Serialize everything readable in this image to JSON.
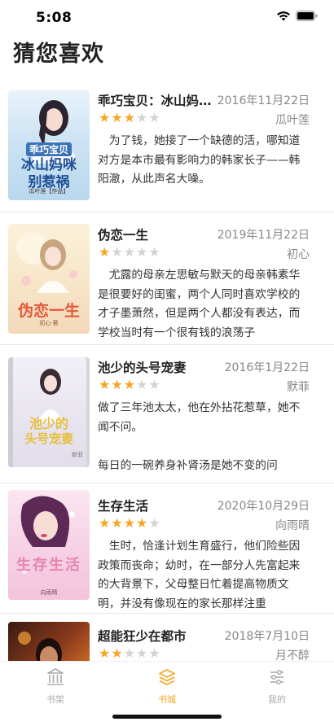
{
  "status": {
    "time": "5:08"
  },
  "page": {
    "title": "猜您喜欢"
  },
  "books": [
    {
      "title": "乖巧宝贝：冰山妈…",
      "date": "2016年11月22日",
      "author": "瓜叶莲",
      "rating": 3,
      "desc": "　为了钱，她接了一个缺德的活，哪知道对方是本市最有影响力的韩家长子——韩阳澈，从此声名大噪。",
      "cover": {
        "line1": "乖巧宝贝",
        "line2": "冰山妈咪",
        "line3": "别惹祸",
        "credit": "瓜叶莲【作品】"
      }
    },
    {
      "title": "伪恋一生",
      "date": "2019年11月22日",
      "author": "初心",
      "rating": 1,
      "desc": "　尤露的母亲左思敏与默天的母亲韩素华是很要好的闺蜜，两个人同时喜欢学校的才子墨萧然，但是两个人都没有表达，而学校当时有一个很有钱的浪荡子",
      "cover": {
        "line1": "伪恋一生",
        "credit": "初心·著"
      }
    },
    {
      "title": "池少的头号宠妻",
      "date": "2016年1月22日",
      "author": "默菲",
      "rating": 3,
      "desc": "做了三年池太太，他在外拈花惹草，她不闻不问。\n\n每日的一碗养身补肾汤是她不变的问",
      "cover": {
        "line1": "池少的",
        "line2": "头号宠妻",
        "credit": "默菲"
      }
    },
    {
      "title": "生存生活",
      "date": "2020年10月29日",
      "author": "向雨晴",
      "rating": 4,
      "desc": "　生时，恰逢计划生育盛行，他们险些因政策而丧命；幼时，在一部分人先富起来的大背景下，父母整日忙着提高物质文明，并没有像现在的家长那样注重",
      "cover": {
        "line1": "生存生活",
        "credit": "向雨晴"
      }
    },
    {
      "title": "超能狂少在都市",
      "date": "2018年7月10日",
      "author": "月不醉",
      "rating": 2,
      "desc": "",
      "cover": {
        "line1": ""
      }
    }
  ],
  "tabs": [
    {
      "label": "书架",
      "icon": "bookshelf-icon"
    },
    {
      "label": "书城",
      "icon": "bookstore-icon",
      "active": true
    },
    {
      "label": "我的",
      "icon": "profile-settings-icon"
    }
  ],
  "colors": {
    "accent": "#f5a623",
    "star_off": "#d3d3d3",
    "muted": "#888888"
  }
}
